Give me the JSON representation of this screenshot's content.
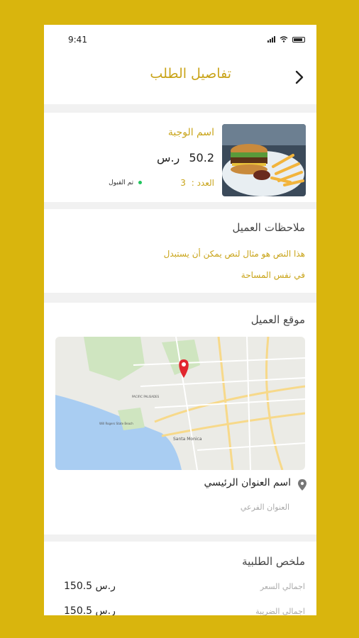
{
  "status_bar": {
    "time": "9:41"
  },
  "header": {
    "title": "تفاصيل الطلب"
  },
  "meal": {
    "name": "اسم الوجبة",
    "price": "50.2",
    "currency": "ر.س",
    "count_label": "العدد :",
    "count": "3",
    "status": "تم القبول"
  },
  "notes": {
    "title": "ملاحظات العميل",
    "line1": "هذا النص هو مثال لنص يمكن أن يستبدل",
    "line2": "في نفس المساحة"
  },
  "location": {
    "title": "موقع العميل",
    "main_address": "اسم العنوان الرئيسي",
    "sub_address": "العنوان الفرعي",
    "map_labels": [
      "Santa Monica",
      "PACIFIC PALISADES",
      "Will Rogers State Beach"
    ]
  },
  "summary": {
    "title": "ملخص الطلبية",
    "rows": [
      {
        "label": "اجمالي السعر",
        "value": "150.5",
        "currency": "ر.س"
      },
      {
        "label": "اجمالي الضريبة",
        "value": "150.5",
        "currency": "ر.س"
      }
    ]
  },
  "colors": {
    "accent": "#c9a419",
    "background": "#d9b50d",
    "status_dot": "#22c55e"
  }
}
